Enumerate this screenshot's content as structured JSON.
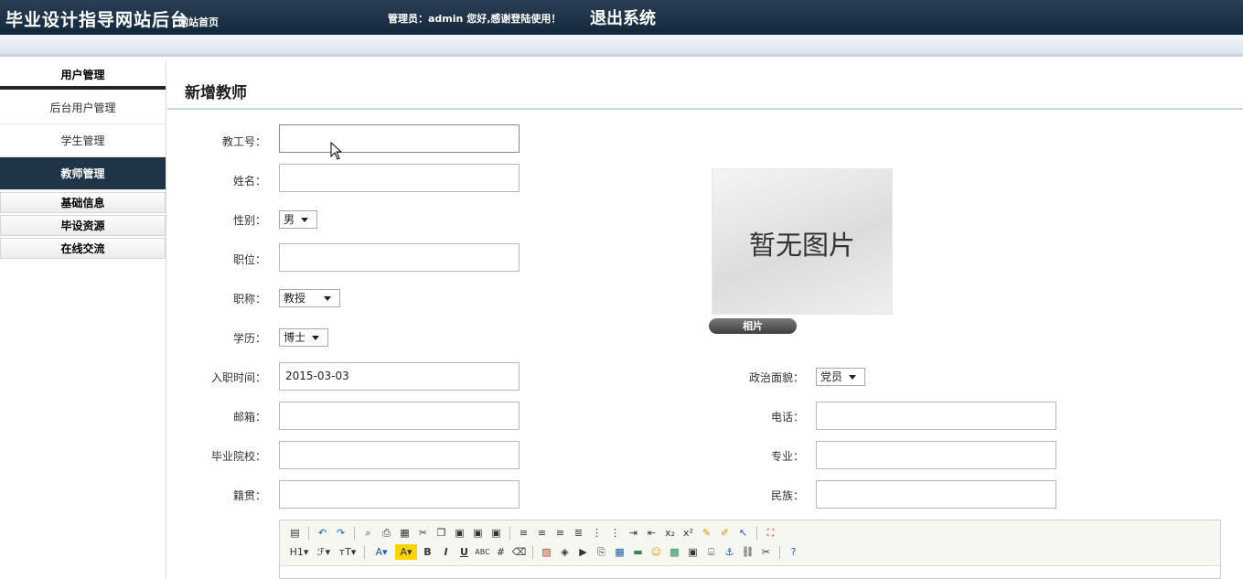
{
  "header": {
    "site_title": "毕业设计指导网站后台",
    "home_link": "网站首页",
    "greeting": "管理员：admin 您好,感谢登陆使用！",
    "logout": "退出系统"
  },
  "sidebar": {
    "section_title": "用户管理",
    "items": [
      {
        "label": "后台用户管理",
        "active": false
      },
      {
        "label": "学生管理",
        "active": false
      },
      {
        "label": "教师管理",
        "active": true
      }
    ],
    "groups": [
      "基础信息",
      "毕设资源",
      "在线交流"
    ]
  },
  "page": {
    "title": "新增教师"
  },
  "form": {
    "staff_no": {
      "label": "教工号：",
      "value": ""
    },
    "name": {
      "label": "姓名：",
      "value": ""
    },
    "gender": {
      "label": "性别：",
      "value": "男"
    },
    "position": {
      "label": "职位：",
      "value": ""
    },
    "title": {
      "label": "职称：",
      "value": "教授"
    },
    "education": {
      "label": "学历：",
      "value": "博士"
    },
    "hire_date": {
      "label": "入职时间：",
      "value": "2015-03-03"
    },
    "political": {
      "label": "政治面貌：",
      "value": "党员"
    },
    "email": {
      "label": "邮箱：",
      "value": ""
    },
    "phone": {
      "label": "电话：",
      "value": ""
    },
    "school": {
      "label": "毕业院校：",
      "value": ""
    },
    "major": {
      "label": "专业：",
      "value": ""
    },
    "hometown": {
      "label": "籍贯：",
      "value": ""
    },
    "ethnicity": {
      "label": "民族：",
      "value": ""
    }
  },
  "photo": {
    "placeholder_text": "暂无图片",
    "button_label": "相片"
  },
  "editor": {
    "heading_btn": "H1",
    "font_btn": "ℱ",
    "size_btn": "тT",
    "bold": "B",
    "italic": "I",
    "underline": "U"
  }
}
